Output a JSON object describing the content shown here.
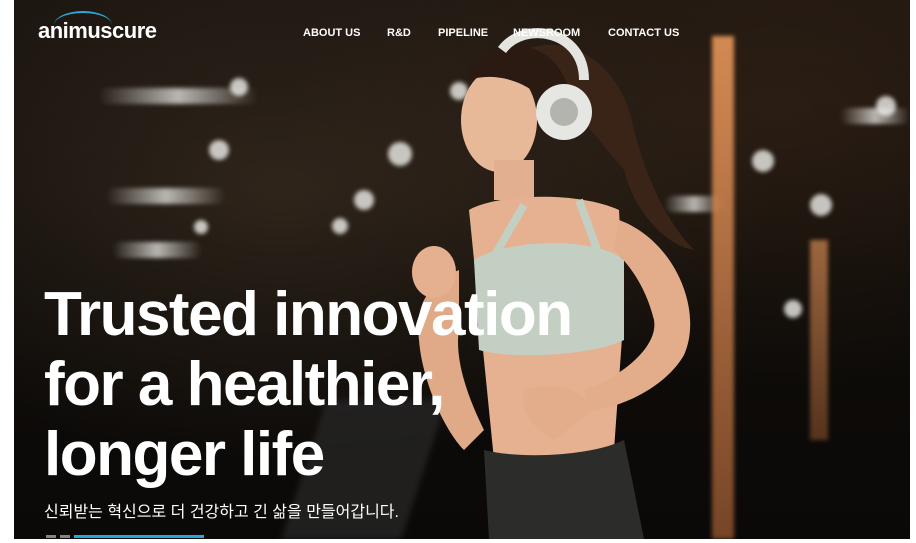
{
  "brand": {
    "logo_text": "animuscure",
    "accent_color": "#2aa7d9"
  },
  "nav": {
    "items": [
      {
        "label": "ABOUT US"
      },
      {
        "label": "R&D"
      },
      {
        "label": "PIPELINE"
      },
      {
        "label": "NEWSROOM"
      },
      {
        "label": "CONTACT US"
      }
    ]
  },
  "hero": {
    "headline_lines": [
      "Trusted innovation",
      "for a healthier,",
      "longer life"
    ],
    "subtitle": "신뢰받는 혁신으로 더 건강하고 긴 삶을 만들어갑니다."
  },
  "slider": {
    "slide_count": 3,
    "active_index": 0
  }
}
